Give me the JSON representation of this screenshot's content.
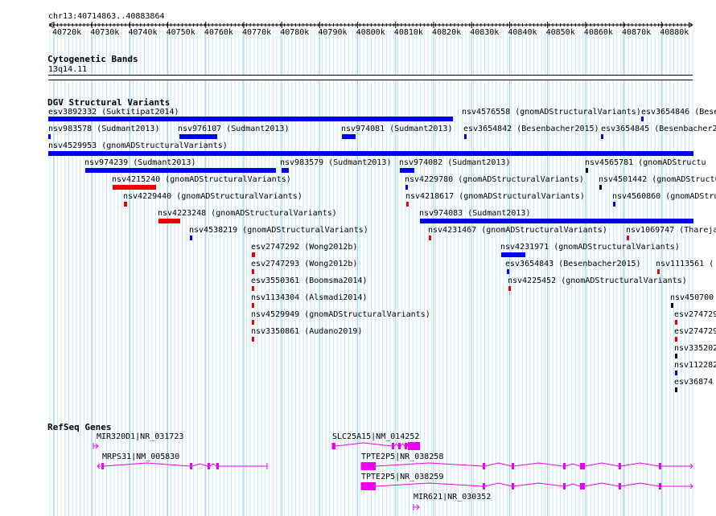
{
  "ruler": {
    "range": "chr13:40714863..40883864",
    "ticks": [
      "40720k",
      "40730k",
      "40740k",
      "40750k",
      "40760k",
      "40770k",
      "40780k",
      "40790k",
      "40800k",
      "40810k",
      "40820k",
      "40830k",
      "40840k",
      "40850k",
      "40860k",
      "40870k",
      "40880k"
    ]
  },
  "cytoband": {
    "title": "Cytogenetic Bands",
    "band": "13q14.11"
  },
  "dgv": {
    "title": "DGV Structural Variants",
    "colors": {
      "gain": "#0000ee",
      "loss": "#ee0000",
      "other": "#000000"
    },
    "labels": [
      "esv3892332 (Suktitipat2014)",
      "nsv4576558 (gnomADStructuralVariants)",
      "esv3654846 (Bese",
      "nsv983578 (Sudmant2013)",
      "nsv976107 (Sudmant2013)",
      "nsv974081 (Sudmant2013)",
      "esv3654842 (Besenbacher2015)",
      "esv3654845 (Besenbacher2",
      "nsv4529953 (gnomADStructuralVariants)",
      "nsv974239 (Sudmant2013)",
      "nsv983579 (Sudmant2013)",
      "nsv974082 (Sudmant2013)",
      "nsv4565781 (gnomADStructu",
      "nsv4215240 (gnomADStructuralVariants)",
      "nsv4229780 (gnomADStructuralVariants)",
      "nsv4501442 (gnomADStructu",
      "nsv4229440 (gnomADStructuralVariants)",
      "nsv4218617 (gnomADStructuralVariants)",
      "nsv4560860 (gnomADStructur",
      "nsv4223248 (gnomADStructuralVariants)",
      "nsv974083 (Sudmant2013)",
      "nsv4538219 (gnomADStructuralVariants)",
      "nsv4231467 (gnomADStructuralVariants)",
      "nsv1069747 (Thareja",
      "esv2747292 (Wong2012b)",
      "nsv4231971 (gnomADStructuralVariants)",
      "esv2747293 (Wong2012b)",
      "esv3654843 (Besenbacher2015)",
      "nsv1113561 (",
      "esv3550361 (Boomsma2014)",
      "nsv4225452 (gnomADStructuralVariants)",
      "nsv1134304 (Alsmadi2014)",
      "nsv450700",
      "nsv4529949 (gnomADStructuralVariants)",
      "esv274729",
      "nsv3350861 (Audano2019)",
      "esv274729",
      "nsv335202",
      "nsv112282",
      "esv36874"
    ]
  },
  "refseq": {
    "title": "RefSeq Genes",
    "color": "#ee00ee",
    "genes": [
      "MIR320D1|NR_031723",
      "MRPS31|NM_005830",
      "SLC25A15|NM_014252",
      "TPTE2P5|NR_038258",
      "TPTE2P5|NR_038259",
      "MIR621|NR_030352"
    ]
  }
}
